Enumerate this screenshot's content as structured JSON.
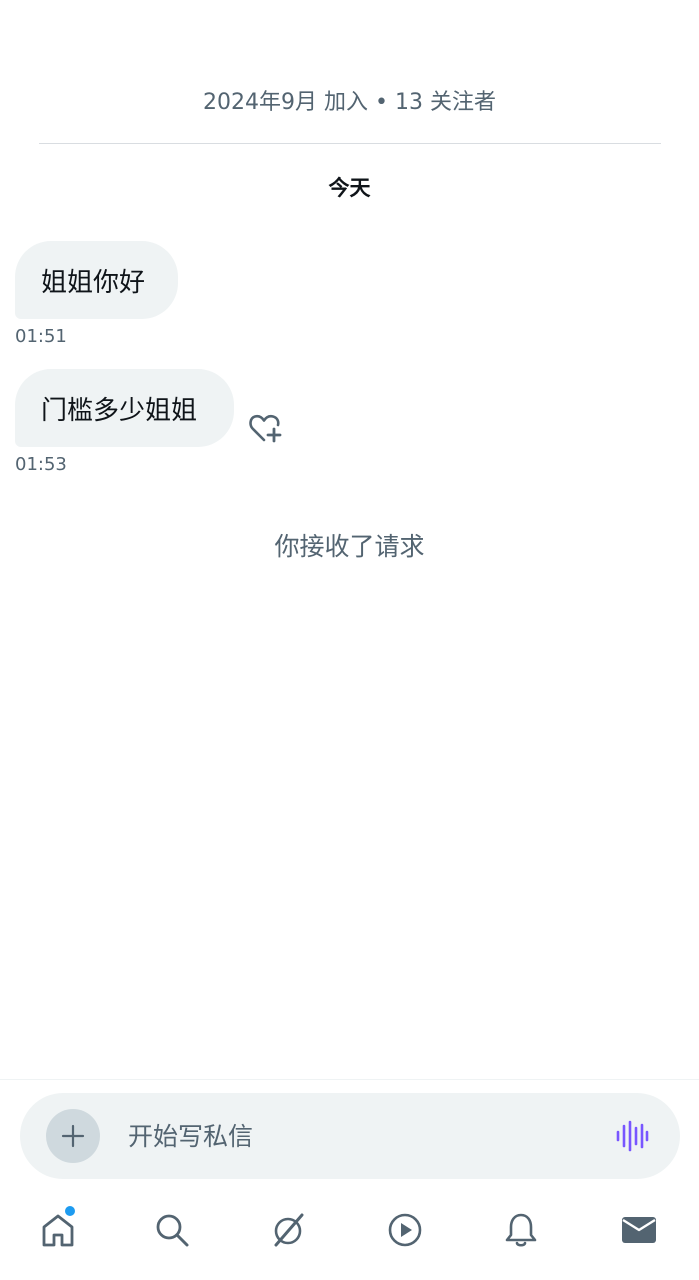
{
  "profile": {
    "join_info": "2024年9月 加入 • 13 关注者"
  },
  "conversation": {
    "date_label": "今天",
    "messages": [
      {
        "text": "姐姐你好",
        "time": "01:51"
      },
      {
        "text": "门槛多少姐姐",
        "time": "01:53"
      }
    ],
    "system_message": "你接收了请求"
  },
  "composer": {
    "placeholder": "开始写私信"
  },
  "tabbar": {
    "items": [
      "home-icon",
      "search-icon",
      "grok-icon",
      "video-icon",
      "bell-icon",
      "mail-icon"
    ],
    "home_has_notification": true
  },
  "colors": {
    "accent": "#1d9bf0",
    "voice": "#7856ff",
    "bubble": "#eff3f4",
    "secondary_text": "#536471"
  }
}
